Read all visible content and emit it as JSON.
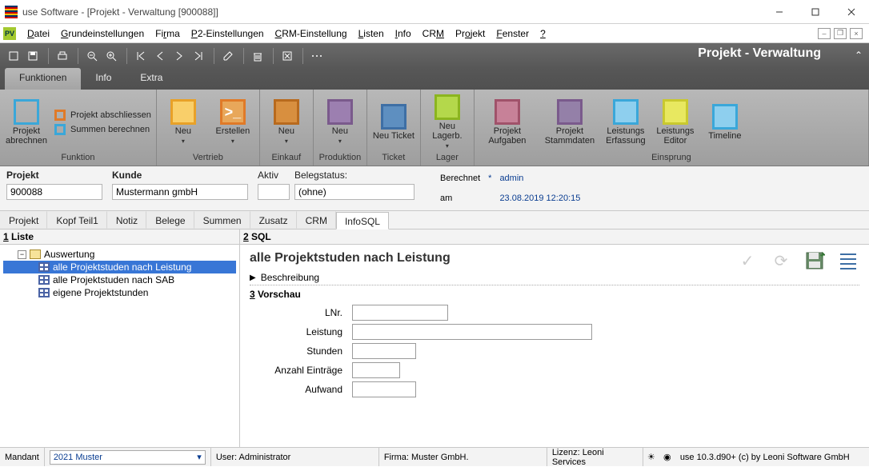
{
  "titlebar": {
    "title": "use Software - [Projekt - Verwaltung [900088]]"
  },
  "menubar": {
    "icon": "PV",
    "items": [
      "Datei",
      "Grundeinstellungen",
      "Firma",
      "P2-Einstellungen",
      "CRM-Einstellung",
      "Listen",
      "Info",
      "CRM",
      "Projekt",
      "Fenster",
      "?"
    ]
  },
  "page_title": "Projekt - Verwaltung",
  "ribbon_tabs": [
    "Funktionen",
    "Info",
    "Extra"
  ],
  "ribbon_active_tab": 0,
  "ribbon": {
    "funktion": {
      "label": "Funktion",
      "abrechnen": "Projekt abrechnen",
      "abschliessen": "Projekt abschliessen",
      "summen": "Summen berechnen"
    },
    "vertrieb": {
      "label": "Vertrieb",
      "neu": "Neu",
      "erstellen": "Erstellen"
    },
    "einkauf": {
      "label": "Einkauf",
      "neu": "Neu"
    },
    "produktion": {
      "label": "Produktion",
      "neu": "Neu"
    },
    "ticket": {
      "label": "Ticket",
      "neu": "Neu Ticket"
    },
    "lager": {
      "label": "Lager",
      "neu": "Neu Lagerb."
    },
    "einsprung": {
      "label": "Einsprung",
      "aufgaben": "Projekt Aufgaben",
      "stamm": "Projekt Stammdaten",
      "erfassung": "Leistungs Erfassung",
      "editor": "Leistungs Editor",
      "timeline": "Timeline"
    }
  },
  "info_row": {
    "projekt_label": "Projekt",
    "projekt_value": "900088",
    "kunde_label": "Kunde",
    "kunde_value": "Mustermann gmbH",
    "aktiv_label": "Aktiv",
    "aktiv_value": "",
    "beleg_label": "Belegstatus:",
    "beleg_value": "(ohne)",
    "berechnet_label": "Berechnet am",
    "star": "*",
    "user": "admin",
    "date": "23.08.2019 12:20:15"
  },
  "sub_tabs": [
    "Projekt",
    "Kopf Teil1",
    "Notiz",
    "Belege",
    "Summen",
    "Zusatz",
    "CRM",
    "InfoSQL"
  ],
  "sub_tab_active": 7,
  "left": {
    "header": "1 Liste",
    "root": "Auswertung",
    "items": [
      "alle Projektstuden nach Leistung",
      "alle Projektstuden nach SAB",
      "eigene Projektstunden"
    ],
    "selected": 0
  },
  "right": {
    "header": "2 SQL",
    "title": "alle Projektstuden nach Leistung",
    "desc_label": "Beschreibung",
    "sect3": "3 Vorschau",
    "fields": {
      "lnr": "LNr.",
      "leistung": "Leistung",
      "stunden": "Stunden",
      "anzahl": "Anzahl Einträge",
      "aufwand": "Aufwand"
    }
  },
  "statusbar": {
    "mandant_label": "Mandant",
    "mandant_value": "2021 Muster",
    "user": "User: Administrator",
    "firma": "Firma: Muster GmbH.",
    "lizenz": "Lizenz: Leoni Services",
    "version": "use 10.3.d90+ (c) by Leoni Software GmbH"
  }
}
